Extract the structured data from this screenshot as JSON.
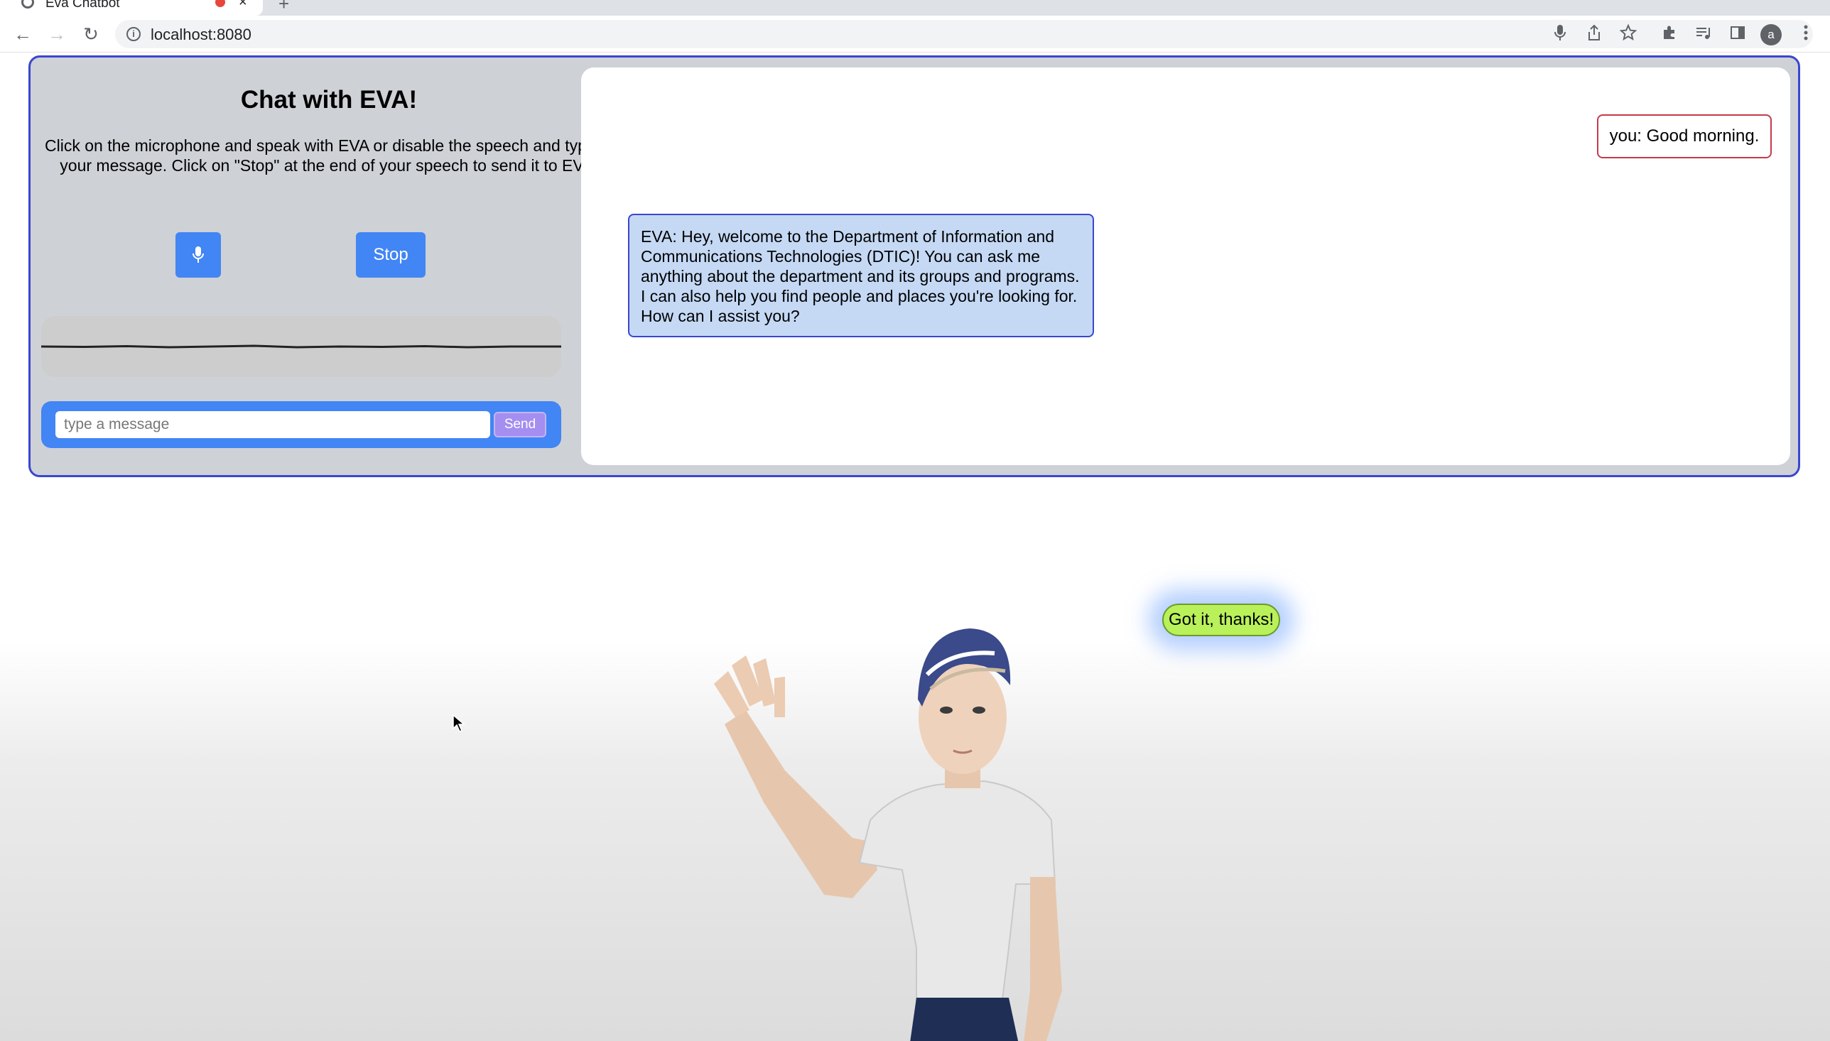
{
  "browser": {
    "tab_title": "Eva Chatbot",
    "tab_close": "×",
    "new_tab": "+",
    "url": "localhost:8080",
    "info_icon": "i",
    "back": "←",
    "forward": "→",
    "reload": "↻",
    "profile_initial": "a"
  },
  "panel": {
    "title": "Chat with EVA!",
    "description": "Click on the microphone and speak with EVA or disable the speech and type in your message. Click on \"Stop\" at the end of your speech to send it to EVA.",
    "stop_label": "Stop",
    "input_placeholder": "type a message",
    "send_label": "Send",
    "accent_color": "#4285f4",
    "border_color": "#3a46d0"
  },
  "chat": {
    "messages": [
      {
        "sender": "user",
        "text": "you: Good morning."
      },
      {
        "sender": "eva",
        "text": "EVA: Hey, welcome to the Department of Information and Communications Technologies (DTIC)! You can ask me anything about the department and its groups and programs. I can also help you find people and places you're looking for. How can I assist you?"
      }
    ]
  },
  "avatar": {
    "speech_bubble": "Got it, thanks!",
    "bubble_color": "#b9f15a"
  }
}
